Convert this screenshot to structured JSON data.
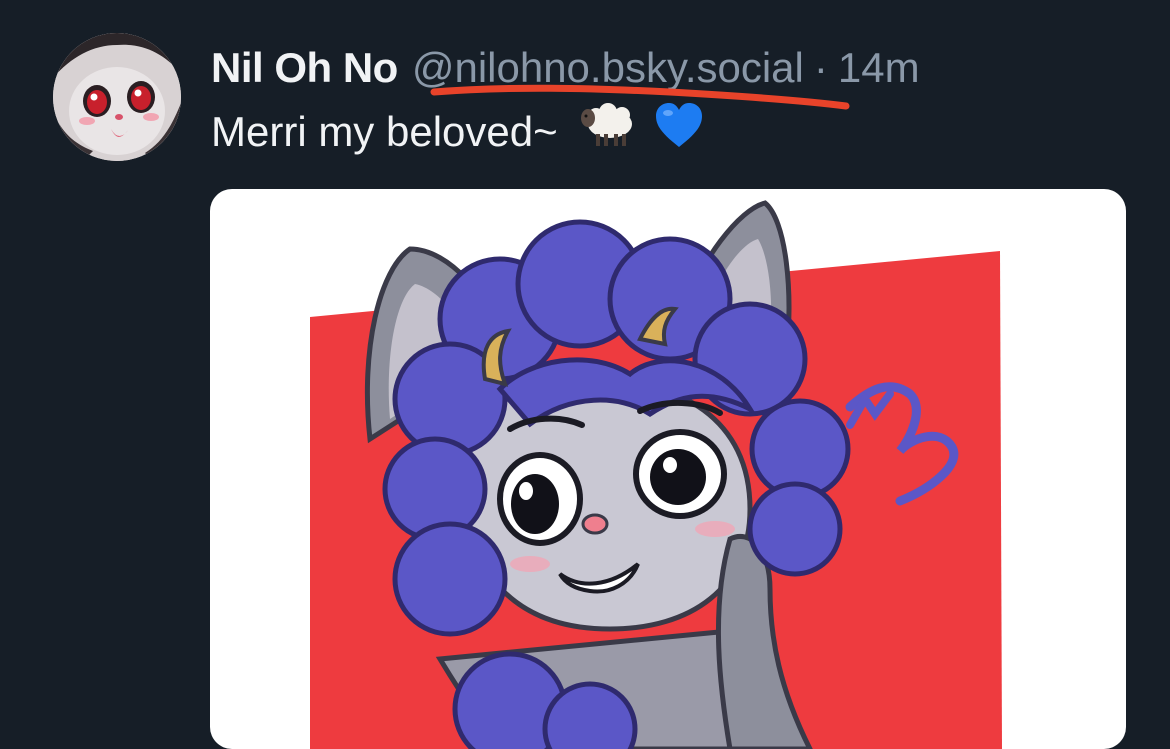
{
  "post": {
    "author": {
      "display_name": "Nil Oh No",
      "handle": "@nilohno.bsky.social",
      "avatar_icon": "avatar-image"
    },
    "separator": "·",
    "timestamp": "14m",
    "text": "Merri my beloved~",
    "emojis": [
      "sheep-emoji",
      "blue-heart-emoji"
    ],
    "image": {
      "icon": "character-artwork"
    }
  },
  "colors": {
    "background": "#161e27",
    "text_primary": "#f1f3f5",
    "text_secondary": "#8a98a8",
    "highlight_underline": "#e8432a",
    "artwork_red": "#ee3b3f",
    "artwork_hair": "#5b57c7",
    "blue_heart": "#1d7cf2"
  }
}
